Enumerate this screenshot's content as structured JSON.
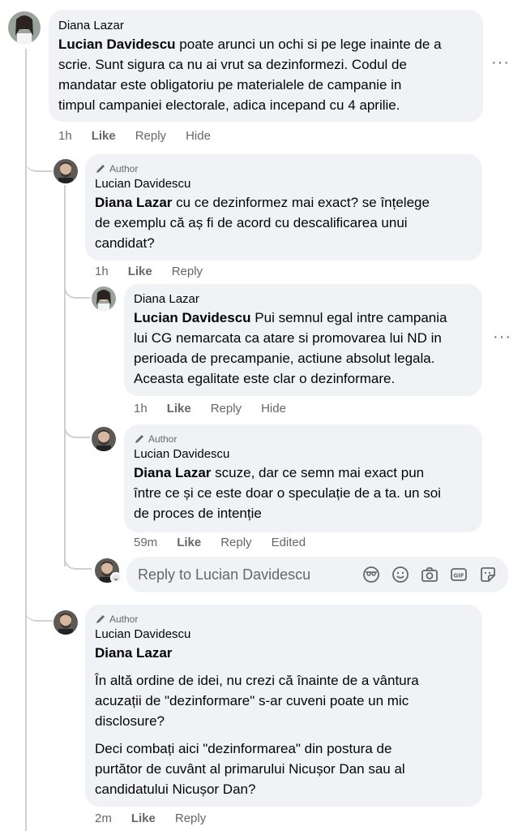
{
  "comments": [
    {
      "author": "Diana Lazar",
      "mention": "Lucian Davidescu",
      "lines": [
        " poate arunci un ochi si pe lege inainte de a",
        "scrie. Sunt sigura ca nu ai vrut sa dezinformezi. Codul de",
        "mandatar este obligatoriu pe materialele de campanie in",
        "timpul campaniei electorale, adica incepand cu 4 aprilie."
      ],
      "time": "1h",
      "like": "Like",
      "reply": "Reply",
      "extra": "Hide"
    },
    {
      "badge": "Author",
      "author": "Lucian Davidescu",
      "mention": "Diana Lazar",
      "lines": [
        " cu ce dezinformez mai exact? se înțelege",
        "de exemplu că aș fi de acord cu descalificarea unui",
        "candidat?"
      ],
      "time": "1h",
      "like": "Like",
      "reply": "Reply"
    },
    {
      "author": "Diana Lazar",
      "mention": "Lucian Davidescu",
      "lines": [
        " Pui semnul egal intre campania",
        "lui CG nemarcata ca atare si promovarea lui ND in",
        "perioada de precampanie, actiune absolut legala.",
        "Aceasta egalitate este clar o dezinformare."
      ],
      "time": "1h",
      "like": "Like",
      "reply": "Reply",
      "extra": "Hide"
    },
    {
      "badge": "Author",
      "author": "Lucian Davidescu",
      "mention": "Diana Lazar",
      "lines": [
        " scuze, dar ce semn mai exact pun",
        "între ce și ce este doar o speculație de a ta. un soi",
        "de proces de intenție"
      ],
      "time": "59m",
      "like": "Like",
      "reply": "Reply",
      "extra": "Edited"
    },
    {
      "badge": "Author",
      "author": "Lucian Davidescu",
      "mention": "Diana Lazar",
      "para1": [
        "În altă ordine de idei, nu crezi că înainte de a vântura",
        "acuzații de \"dezinformare\" s-ar cuveni poate un mic",
        "disclosure?"
      ],
      "para2": [
        "Deci combați aici \"dezinformarea\" din postura de",
        "purtător de cuvânt al primarului Nicușor Dan sau al",
        "candidatului Nicușor Dan?"
      ],
      "time": "2m",
      "like": "Like",
      "reply": "Reply"
    }
  ],
  "reply_box": {
    "placeholder": "Reply to Lucian Davidescu",
    "icons": [
      "avatar-sticker-icon",
      "emoji-icon",
      "camera-icon",
      "gif-icon",
      "sticker-icon"
    ]
  },
  "more_menu_glyph": "···",
  "colors": {
    "bubble": "#f0f2f5",
    "meta": "#65676b",
    "thread_line": "#ced0d4"
  }
}
